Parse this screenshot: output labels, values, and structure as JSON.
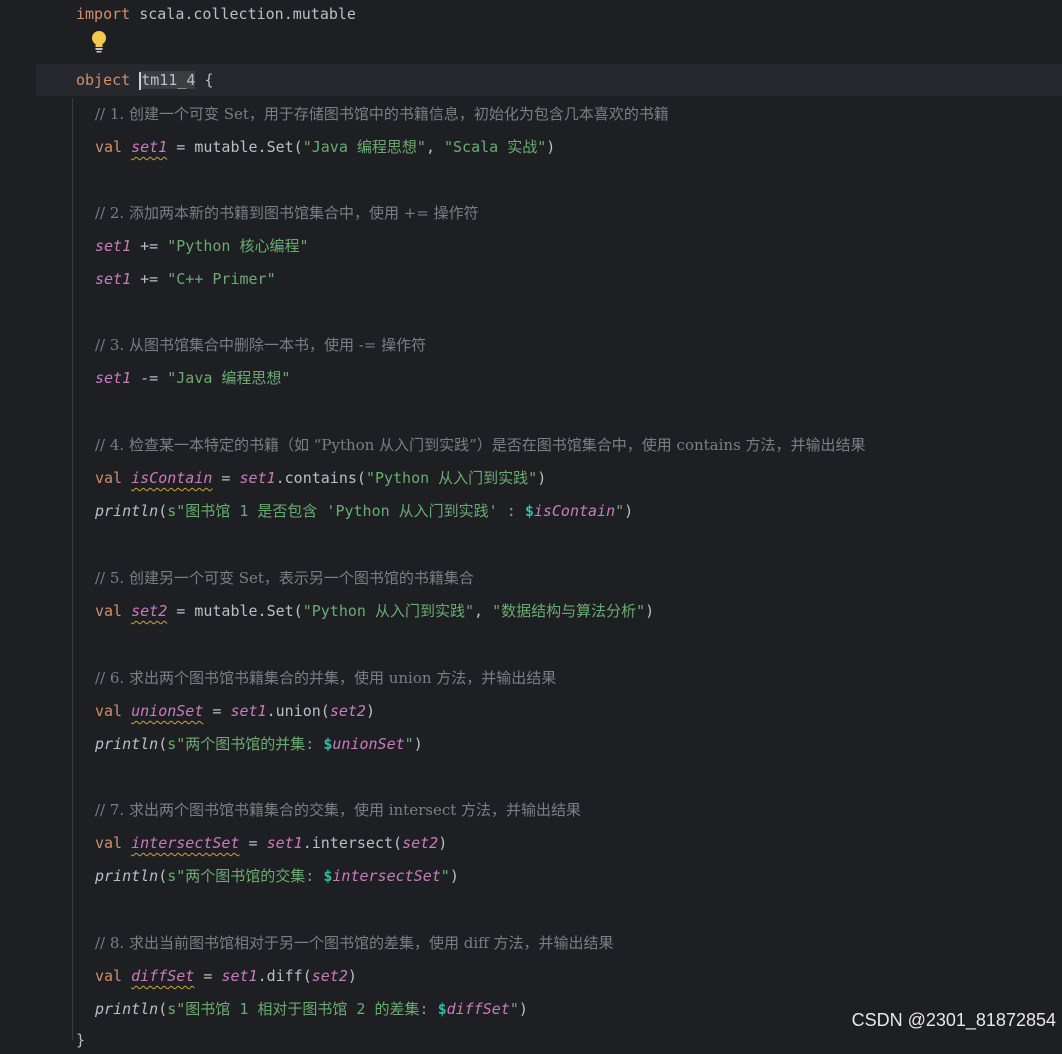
{
  "editor": {
    "import_kw": "import",
    "import_path": "scala.collection.mutable",
    "object_kw": "object",
    "object_name": "tm11_4",
    "object_brace": "{",
    "closing_brace": "}",
    "lines": {
      "c1": "// 1. 创建一个可变 Set，用于存储图书馆中的书籍信息，初始化为包含几本喜欢的书籍",
      "l1_val": "val",
      "l1_name": "set1",
      "l1_rest": " = mutable.Set(",
      "l1_s1": "\"Java 编程思想\"",
      "l1_sep": ", ",
      "l1_s2": "\"Scala 实战\"",
      "l1_end": ")",
      "c2": "// 2. 添加两本新的书籍到图书馆集合中，使用 += 操作符",
      "l2_var": "set1",
      "l2_op": " += ",
      "l2_str": "\"Python 核心编程\"",
      "l3_var": "set1",
      "l3_op": " += ",
      "l3_str": "\"C++ Primer\"",
      "c3": "// 3. 从图书馆集合中删除一本书，使用 -= 操作符",
      "l4_var": "set1",
      "l4_op": " -= ",
      "l4_str": "\"Java 编程思想\"",
      "c4": "// 4. 检查某一本特定的书籍（如 “Python 从入门到实践”）是否在图书馆集合中，使用 contains 方法，并输出结果",
      "l5_val": "val",
      "l5_name": "isContain",
      "l5_eq": " = ",
      "l5_var": "set1",
      "l5_call": ".contains(",
      "l5_str": "\"Python 从入门到实践\"",
      "l5_end": ")",
      "l6_fn": "println",
      "l6_open": "(",
      "l6_str": "s\"图书馆 1 是否包含 'Python 从入门到实践' : ",
      "l6_interp": "$",
      "l6_ivar": "isContain",
      "l6_close_str": "\"",
      "l6_end": ")",
      "c5": "// 5. 创建另一个可变 Set，表示另一个图书馆的书籍集合",
      "l7_val": "val",
      "l7_name": "set2",
      "l7_rest": " = mutable.Set(",
      "l7_s1": "\"Python 从入门到实践\"",
      "l7_sep": ", ",
      "l7_s2": "\"数据结构与算法分析\"",
      "l7_end": ")",
      "c6": "// 6. 求出两个图书馆书籍集合的并集，使用 union 方法，并输出结果",
      "l8_val": "val",
      "l8_name": "unionSet",
      "l8_eq": " = ",
      "l8_var": "set1",
      "l8_call": ".union(",
      "l8_arg": "set2",
      "l8_end": ")",
      "l9_fn": "println",
      "l9_open": "(",
      "l9_str": "s\"两个图书馆的并集: ",
      "l9_interp": "$",
      "l9_ivar": "unionSet",
      "l9_close_str": "\"",
      "l9_end": ")",
      "c7": "// 7. 求出两个图书馆书籍集合的交集，使用 intersect 方法，并输出结果",
      "l10_val": "val",
      "l10_name": "intersectSet",
      "l10_eq": " = ",
      "l10_var": "set1",
      "l10_call": ".intersect(",
      "l10_arg": "set2",
      "l10_end": ")",
      "l11_fn": "println",
      "l11_open": "(",
      "l11_str": "s\"两个图书馆的交集: ",
      "l11_interp": "$",
      "l11_ivar": "intersectSet",
      "l11_close_str": "\"",
      "l11_end": ")",
      "c8": "// 8. 求出当前图书馆相对于另一个图书馆的差集，使用 diff 方法，并输出结果",
      "l12_val": "val",
      "l12_name": "diffSet",
      "l12_eq": " = ",
      "l12_var": "set1",
      "l12_call": ".diff(",
      "l12_arg": "set2",
      "l12_end": ")",
      "l13_fn": "println",
      "l13_open": "(",
      "l13_str": "s\"图书馆 1 相对于图书馆 2 的差集: ",
      "l13_interp": "$",
      "l13_ivar": "diffSet",
      "l13_close_str": "\"",
      "l13_end": ")"
    }
  },
  "watermark": "CSDN @2301_81872854",
  "icons": {
    "intention": "lightbulb-icon"
  },
  "colors": {
    "background": "#1e1f22",
    "keyword": "#cf8e6d",
    "string": "#6aab73",
    "comment": "#7a7e85",
    "variable": "#c77dbb",
    "interpolation": "#2fbaa3"
  }
}
